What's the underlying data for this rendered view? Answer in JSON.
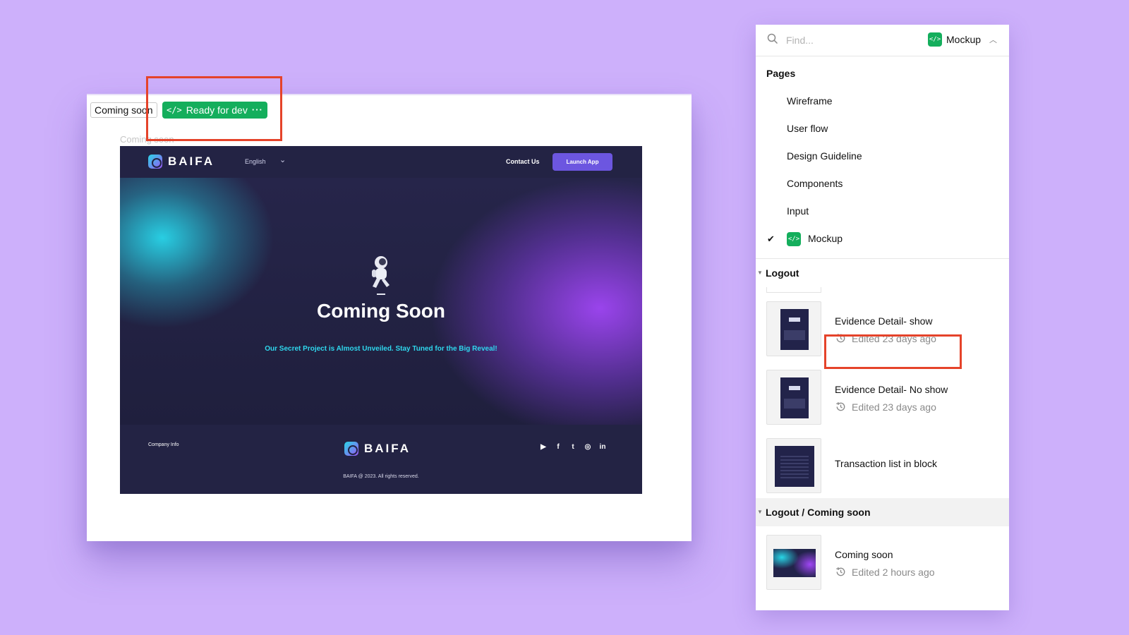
{
  "canvas": {
    "frame_tag": "Coming soon",
    "status_badge": {
      "code_glyph": "</>",
      "label": "Ready for dev",
      "more": "···"
    },
    "frame_sublabel": "Coming soon"
  },
  "site": {
    "brand": "BAIFA",
    "nav": {
      "language": "English",
      "contact": "Contact Us",
      "launch": "Launch App"
    },
    "hero": {
      "title": "Coming Soon",
      "subtitle": "Our Secret Project is Almost Unveiled.  Stay Tuned for the Big Reveal!",
      "cyan": "#28d6e6",
      "purple": "#a046f5"
    },
    "footer": {
      "company_info": "Company Info",
      "copyright": "BAIFA @ 2023. All rights reserved.",
      "socials": [
        "youtube-icon",
        "facebook-icon",
        "twitter-icon",
        "instagram-icon",
        "linkedin-icon"
      ],
      "social_glyphs": [
        "▶",
        "f",
        "t",
        "◎",
        "in"
      ]
    }
  },
  "panel": {
    "search": {
      "placeholder": "Find...",
      "value": ""
    },
    "current_page": {
      "code_glyph": "</>",
      "label": "Mockup"
    },
    "pages_heading": "Pages",
    "pages": [
      "Wireframe",
      "User flow",
      "Design Guideline",
      "Components",
      "Input",
      "Mockup"
    ],
    "sections": [
      {
        "title": "Logout",
        "frames": [
          {
            "name": "Evidence Detail- show",
            "edited": "Edited 23 days ago"
          },
          {
            "name": "Evidence Detail- No show",
            "edited": "Edited 23 days ago"
          },
          {
            "name": "Transaction list in block",
            "edited": ""
          }
        ]
      },
      {
        "title": "Logout / Coming soon",
        "frames": [
          {
            "name": "Coming soon",
            "edited": "Edited 2 hours ago"
          }
        ]
      }
    ]
  },
  "colors": {
    "background": "#cdb0fb",
    "accent_green": "#14ae5c",
    "highlight_red": "#e5432a",
    "launch_button": "#6c56e0"
  }
}
